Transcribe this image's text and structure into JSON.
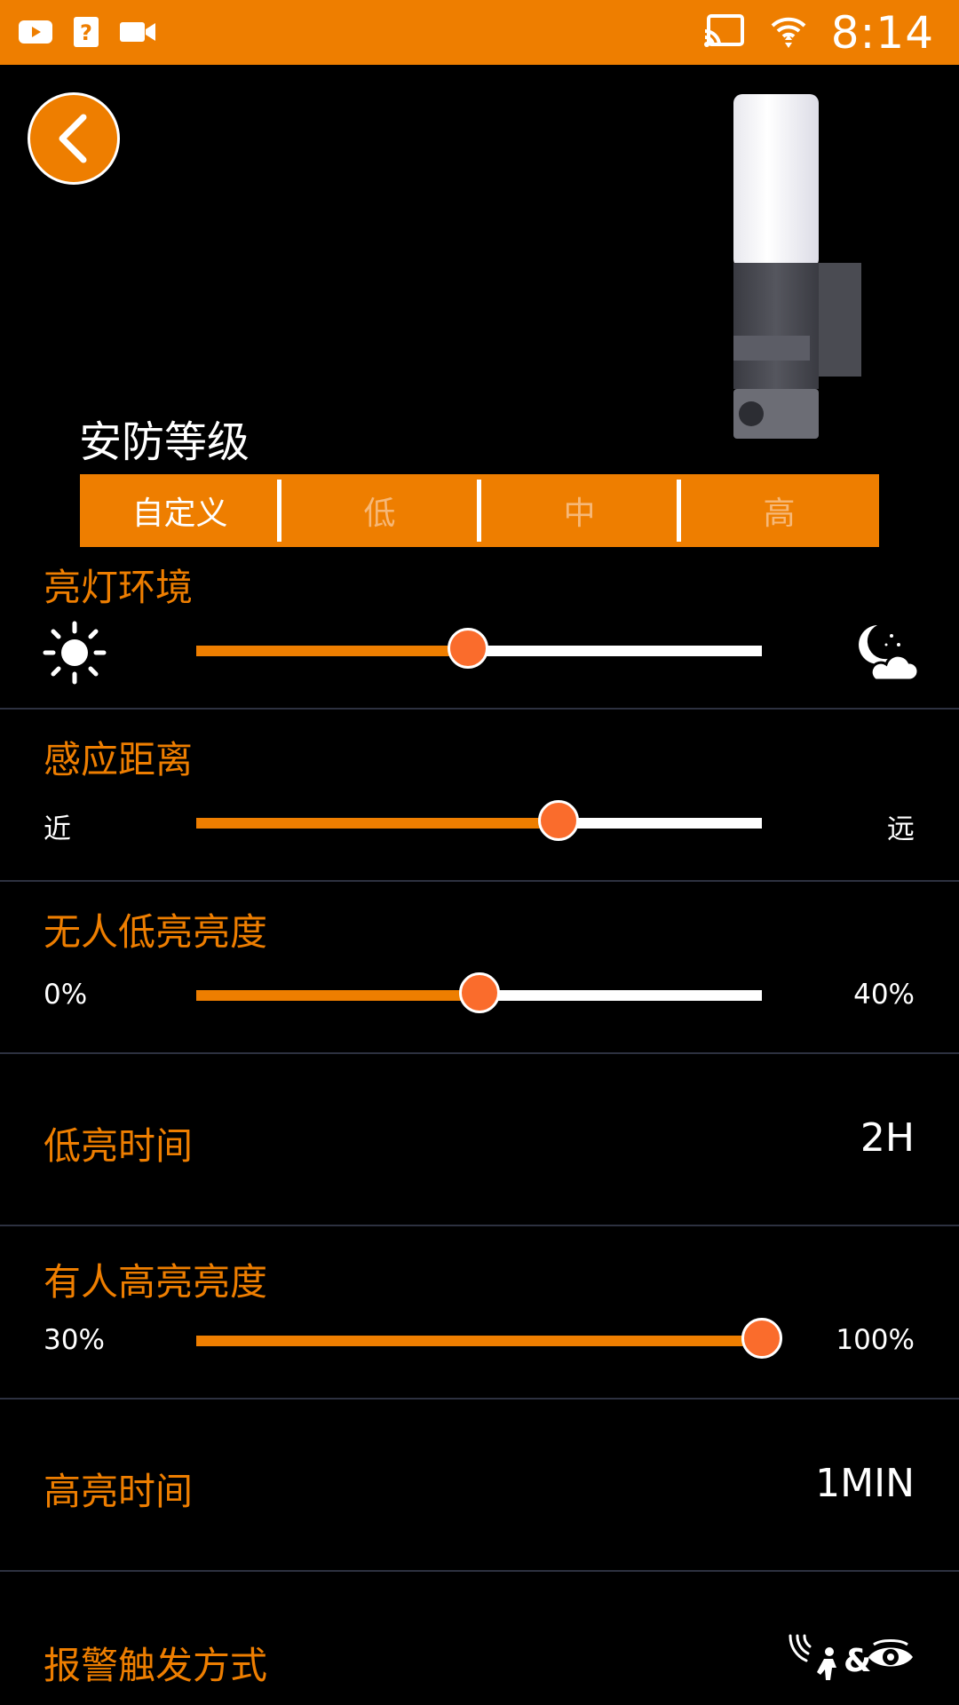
{
  "status_bar": {
    "time": "8:14",
    "left_icons": [
      "youtube-icon",
      "help-icon",
      "video-camera-icon"
    ],
    "right_icons": [
      "cast-icon",
      "wifi-icon"
    ]
  },
  "header": {
    "back_icon": "chevron-left-icon"
  },
  "security_level": {
    "title": "安防等级",
    "options": [
      "自定义",
      "低",
      "中",
      "高"
    ],
    "selected": "自定义"
  },
  "settings": {
    "ambient": {
      "label": "亮灯环境",
      "left_icon": "sun-icon",
      "right_icon": "moon-cloud-icon",
      "value": 0.48
    },
    "distance": {
      "label": "感应距离",
      "min_label": "近",
      "max_label": "远",
      "value": 0.64
    },
    "idle_brightness": {
      "label": "无人低亮亮度",
      "min_label": "0%",
      "max_label": "40%",
      "value": 0.5
    },
    "low_time": {
      "label": "低亮时间",
      "value": "2H"
    },
    "active_brightness": {
      "label": "有人高亮亮度",
      "min_label": "30%",
      "max_label": "100%",
      "value": 1.0
    },
    "high_time": {
      "label": "高亮时间",
      "value": "1MIN"
    },
    "alarm": {
      "label": "报警触发方式",
      "icon": "motion-and-eye-icon"
    }
  },
  "colors": {
    "accent": "#EE7E00",
    "thumb": "#FA6C2C",
    "background": "#000000",
    "divider": "#2d3140"
  }
}
